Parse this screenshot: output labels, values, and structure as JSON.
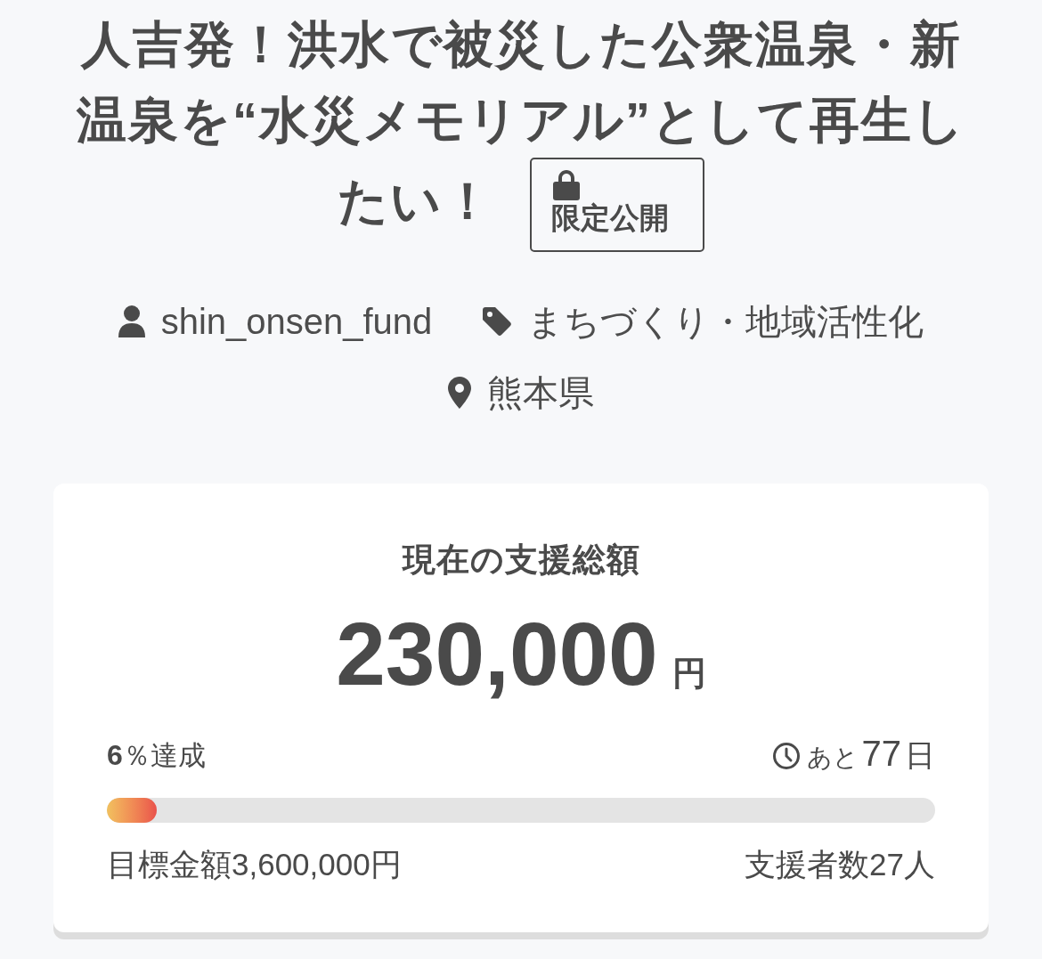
{
  "title": "人吉発！洪水で被災した公衆温泉・新温泉を“水災メモリアル”として再生したい！",
  "badge": {
    "label": "限定公開"
  },
  "meta": [
    {
      "kind": "user",
      "text": "shin_onsen_fund"
    },
    {
      "kind": "category",
      "text": "まちづくり・地域活性化"
    },
    {
      "kind": "location",
      "text": "熊本県"
    }
  ],
  "funding": {
    "heading": "現在の支援総額",
    "amount": "230,000",
    "currency": "円",
    "achievement": {
      "percent": "6",
      "suffix": "％達成"
    },
    "remaining": {
      "prefix": "あと",
      "days": "77",
      "suffix": "日"
    },
    "progress": {
      "level": 0.06
    },
    "goal": "目標金額3,600,000円",
    "backers": "支援者数27人"
  }
}
